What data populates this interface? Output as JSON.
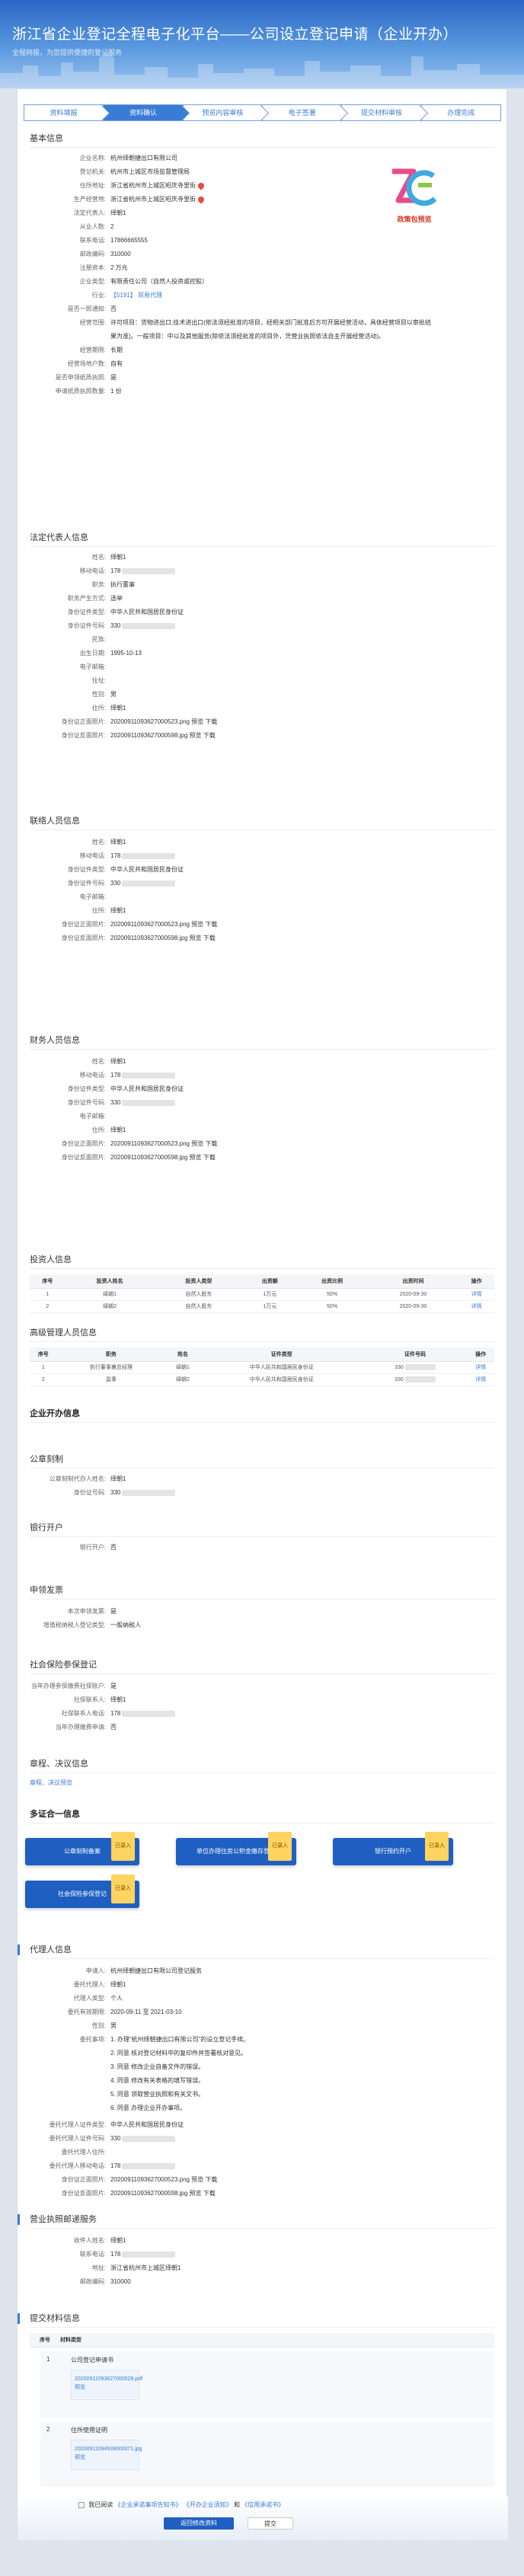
{
  "header": {
    "title": "浙江省企业登记全程电子化平台——公司设立登记申请（企业开办）",
    "subtitle": "全程网报，为您提供便捷的登记服务"
  },
  "steps": [
    "资料填报",
    "资料确认",
    "预览内容审核",
    "电子签署",
    "提交材料审核",
    "办理完成"
  ],
  "logo_caption": "政策包预览",
  "basic": {
    "title": "基本信息",
    "rows": [
      [
        "企业名称:",
        "杭州绎朝捷出口有限公司"
      ],
      [
        "登记机关:",
        "杭州市上城区市场监督管理局"
      ],
      [
        "住所地址:",
        "浙江省杭州市上城区昭庆寺里街"
      ],
      [
        "生产经营地:",
        "浙江省杭州市上城区昭庆寺里街"
      ],
      [
        "法定代表人:",
        "绎朝1"
      ],
      [
        "从业人数:",
        "2"
      ],
      [
        "联系电话:",
        "17866665555"
      ],
      [
        "邮政编码:",
        "310000"
      ],
      [
        "注册资本:",
        "2 万元"
      ],
      [
        "企业类型:",
        "有限责任公司（自然人投资或控股）"
      ],
      [
        "行业:",
        "【5191】 贸易代理"
      ],
      [
        "是否一照通知:",
        "否"
      ]
    ],
    "scope_label": "经营范围:",
    "scope": [
      "许可项目：货物进出口;技术进出口(依法须经批准的项目，经相关部门批准后方可开展经营活动，具体经营项目以审批结",
      "果为准)。一般项目：中以及其他服务(除依法须经批准的项目外，凭营业执照依法自主开展经营活动)。"
    ],
    "rows2": [
      [
        "经营期限:",
        "长期"
      ],
      [
        "经营场地户数:",
        "自有"
      ],
      [
        "是否申领纸质执照:",
        "是"
      ],
      [
        "申请纸质执照数量:",
        "1 份"
      ]
    ]
  },
  "legal": {
    "title": "法定代表人信息",
    "rows": [
      [
        "姓名:",
        "绎朝1"
      ],
      [
        "移动电话:",
        "178"
      ],
      [
        "职务:",
        "执行董事"
      ],
      [
        "职务产生方式:",
        "选举"
      ],
      [
        "身份证件类型:",
        "中华人民共和国居民身份证"
      ],
      [
        "身份证件号码:",
        "330"
      ],
      [
        "民族:",
        ""
      ],
      [
        "出生日期:",
        "1995-10-13"
      ],
      [
        "电子邮箱:",
        ""
      ],
      [
        "住址:",
        ""
      ],
      [
        "性别:",
        "男"
      ],
      [
        "住所:",
        "绎朝1"
      ],
      [
        "身份证正面照片:",
        "20200911093627000523.png 预览 下载"
      ],
      [
        "身份证反面照片:",
        "20200911093627000598.jpg 预览 下载"
      ]
    ]
  },
  "liaison": {
    "title": "联络人员信息",
    "rows": [
      [
        "姓名:",
        "绎朝1"
      ],
      [
        "移动电话:",
        "178"
      ],
      [
        "身份证件类型:",
        "中华人民共和国居民身份证"
      ],
      [
        "身份证件号码:",
        "330"
      ],
      [
        "电子邮箱:",
        ""
      ],
      [
        "住所:",
        "绎朝1"
      ],
      [
        "身份证正面照片:",
        "20200911093627000523.png 预览 下载"
      ],
      [
        "身份证反面照片:",
        "20200911093627000598.jpg 预览 下载"
      ]
    ]
  },
  "finance": {
    "title": "财务人员信息",
    "rows": [
      [
        "姓名:",
        "绎朝1"
      ],
      [
        "移动电话:",
        "178"
      ],
      [
        "身份证件类型:",
        "中华人民共和国居民身份证"
      ],
      [
        "身份证件号码:",
        "330"
      ],
      [
        "电子邮箱:",
        ""
      ],
      [
        "住所:",
        "绎朝1"
      ],
      [
        "身份证正面照片:",
        "20200911093627000523.png 预览 下载"
      ],
      [
        "身份证反面照片:",
        "20200911093627000598.jpg 预览 下载"
      ]
    ]
  },
  "investor": {
    "title": "投资人信息",
    "headers": [
      "序号",
      "投资人姓名",
      "投资人类型",
      "出资额",
      "出资比例",
      "出资时间",
      "操作"
    ],
    "rows": [
      [
        "1",
        "绎朝1",
        "自然人股东",
        "1万元",
        "50%",
        "2020-09-30",
        "详情"
      ],
      [
        "2",
        "绎朝2",
        "自然人股东",
        "1万元",
        "50%",
        "2020-09-30",
        "详情"
      ]
    ]
  },
  "manager": {
    "title": "高级管理人员信息",
    "headers": [
      "序号",
      "职务",
      "姓名",
      "证件类型",
      "证件号码",
      "操作"
    ],
    "rows": [
      [
        "1",
        "执行董事兼总经理",
        "绎朝1",
        "中华人民共和国居民身份证",
        "330",
        "详情"
      ],
      [
        "2",
        "监事",
        "绎朝2",
        "中华人民共和国居民身份证",
        "330",
        "详情"
      ]
    ]
  },
  "kaiban": {
    "title": "企业开办信息"
  },
  "seal": {
    "title": "公章刻制",
    "rows": [
      [
        "公章刻制代办人姓名:",
        "绎朝1"
      ],
      [
        "身份证号码:",
        "330"
      ]
    ]
  },
  "bank": {
    "title": "银行开户",
    "rows": [
      [
        "银行开户:",
        "否"
      ]
    ]
  },
  "invoice": {
    "title": "申领发票",
    "rows": [
      [
        "本次申领发票:",
        "是"
      ],
      [
        "增值税纳税人登记类型:",
        "一般纳税人"
      ]
    ]
  },
  "social": {
    "title": "社会保险参保登记",
    "rows": [
      [
        "当年办理参保缴费社保账户:",
        "是"
      ],
      [
        "社保联系人:",
        "绎朝1"
      ],
      [
        "社保联系人电话:",
        "178"
      ],
      [
        "当年办理缴费申请:",
        "否"
      ]
    ]
  },
  "articles": {
    "title": "章程、决议信息",
    "link": "章程、决议预览"
  },
  "multi": {
    "title": "多证合一信息",
    "tag": "已录入",
    "buttons": [
      "公章刻制备案",
      "单位办理住房公积金缴存登记",
      "银行预约开户",
      "社会保险参保登记"
    ]
  },
  "agent": {
    "title": "代理人信息",
    "rows": [
      [
        "申请人:",
        "杭州绎朝捷出口有限公司登记服务"
      ],
      [
        "委托代理人:",
        "绎朝1"
      ],
      [
        "代理人类型:",
        "个人"
      ],
      [
        "委托有效期限:",
        "2020-09-11 至 2021-03-10"
      ],
      [
        "性别:",
        "男"
      ]
    ],
    "auth_label": "委托事项:",
    "auth": [
      "1. 办理“杭州绎朝捷出口有限公司”的设立登记手续。",
      "2. 同意 核对登记材料中的复印件并签署核对意见。",
      "3. 同意 修改企业自备文件的错误。",
      "4. 同意 修改有关表格的填写错误。",
      "5. 同意 领取营业执照和有关文书。",
      "6. 同意 办理企业开办事项。"
    ],
    "rows2": [
      [
        "委托代理人证件类型:",
        "中华人民共和国居民身份证"
      ],
      [
        "委托代理人证件号码:",
        "330"
      ],
      [
        "委托代理人住所:",
        ""
      ],
      [
        "委托代理人移动电话:",
        "178"
      ],
      [
        "身份证正面照片:",
        "20200911093627000523.png 预览 下载"
      ],
      [
        "身份证反面照片:",
        "20200911093627000598.jpg 预览 下载"
      ]
    ]
  },
  "license": {
    "title": "营业执照邮递服务",
    "rows": [
      [
        "收件人姓名:",
        "绎朝1"
      ],
      [
        "联系电话:",
        "178"
      ],
      [
        "地址:",
        "浙江省杭州市上城区绎朝1"
      ],
      [
        "邮政编码:",
        "310000"
      ]
    ]
  },
  "materials": {
    "title": "提交材料信息",
    "headers": [
      "序号",
      "材料类型"
    ],
    "items": [
      {
        "no": "1",
        "name": "公司登记申请书",
        "file": "20200911093627000528.pdf"
      },
      {
        "no": "2",
        "name": "住所使用证明",
        "file": "20200911094939000071.jpg"
      }
    ],
    "preview": "预览"
  },
  "footer": {
    "agree_prefix": "我已阅读",
    "doc1": "《企业承诺事项告知书》",
    "doc2": "《开办企业须知》",
    "conj": "和",
    "doc3": "《信用承诺书》",
    "back": "返回修改资料",
    "submit": "提交"
  }
}
